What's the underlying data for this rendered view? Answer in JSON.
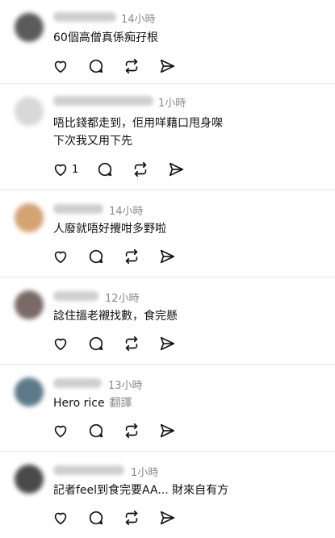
{
  "posts": [
    {
      "time": "14小時",
      "text": [
        "60個高僧真係痴孖根"
      ],
      "likes": "",
      "avatar_color": "#5b5b5b"
    },
    {
      "time": "1小時",
      "text": [
        "唔比錢都走到，佢用咩藉口甩身㗎",
        "下次我又用下先"
      ],
      "likes": "1",
      "avatar_color": "#d8d8d8"
    },
    {
      "time": "14小時",
      "text": [
        "人廢就唔好攪咁多野啦"
      ],
      "likes": "",
      "avatar_color": "#d4a373"
    },
    {
      "time": "12小時",
      "text": [
        "諗住搵老襯找數，食完懸"
      ],
      "likes": "",
      "avatar_color": "#7a6a66"
    },
    {
      "time": "13小時",
      "text": [
        "Hero rice"
      ],
      "translate": "翻譯",
      "likes": "",
      "avatar_color": "#5c7a8a"
    },
    {
      "time": "1小時",
      "text": [
        "記者feel到食完要AA... 財來自有方"
      ],
      "likes": "",
      "avatar_color": "#4a4a4a"
    }
  ],
  "icons": [
    "heart-icon",
    "comment-icon",
    "repost-icon",
    "share-icon"
  ]
}
